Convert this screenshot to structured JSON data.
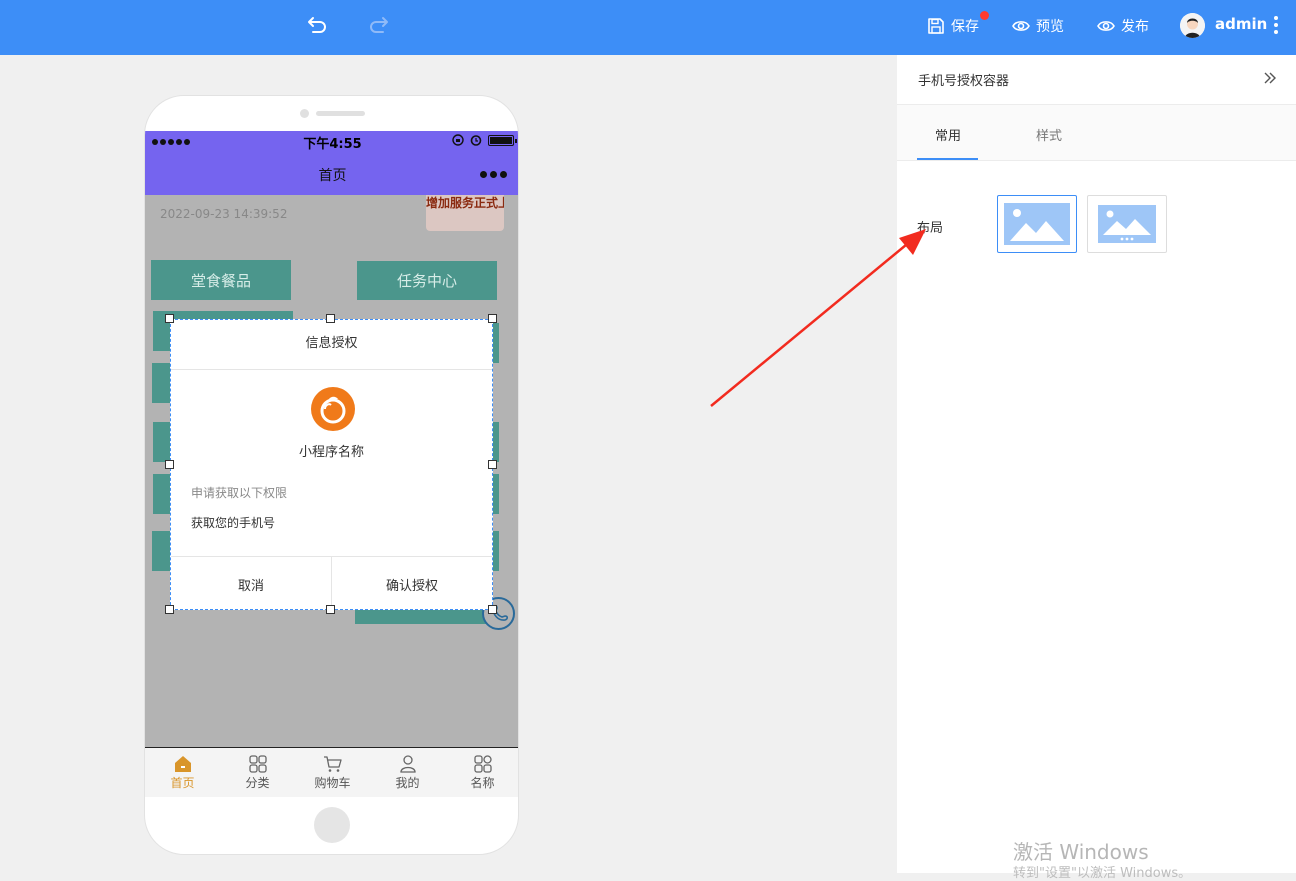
{
  "toolbar": {
    "save_label": "保存",
    "preview_label": "预览",
    "publish_label": "发布",
    "username": "admin"
  },
  "phone": {
    "status_time": "下午4:55",
    "nav_title": "首页",
    "date_text": "2022-09-23 14:39:52",
    "banner_text": "增加服务正式上",
    "blocks": [
      "堂食餐品",
      "任务中心"
    ],
    "tabbar": [
      "首页",
      "分类",
      "购物车",
      "我的",
      "名称"
    ]
  },
  "dialog": {
    "title": "信息授权",
    "app_name": "小程序名称",
    "request_text": "申请获取以下权限",
    "permission_text": "获取您的手机号",
    "cancel_label": "取消",
    "confirm_label": "确认授权"
  },
  "panel": {
    "title": "手机号授权容器",
    "tabs": [
      "常用",
      "样式"
    ],
    "layout_label": "布局"
  },
  "watermark": {
    "line1": "激活 Windows",
    "line2": "转到\"设置\"以激活 Windows。"
  },
  "colors": {
    "topbar": "#3d8ef7",
    "phone_nav": "#7564ef",
    "block_green": "#4b968c",
    "tab_active": "#d9952a",
    "annotation_arrow": "#f22b1f"
  }
}
